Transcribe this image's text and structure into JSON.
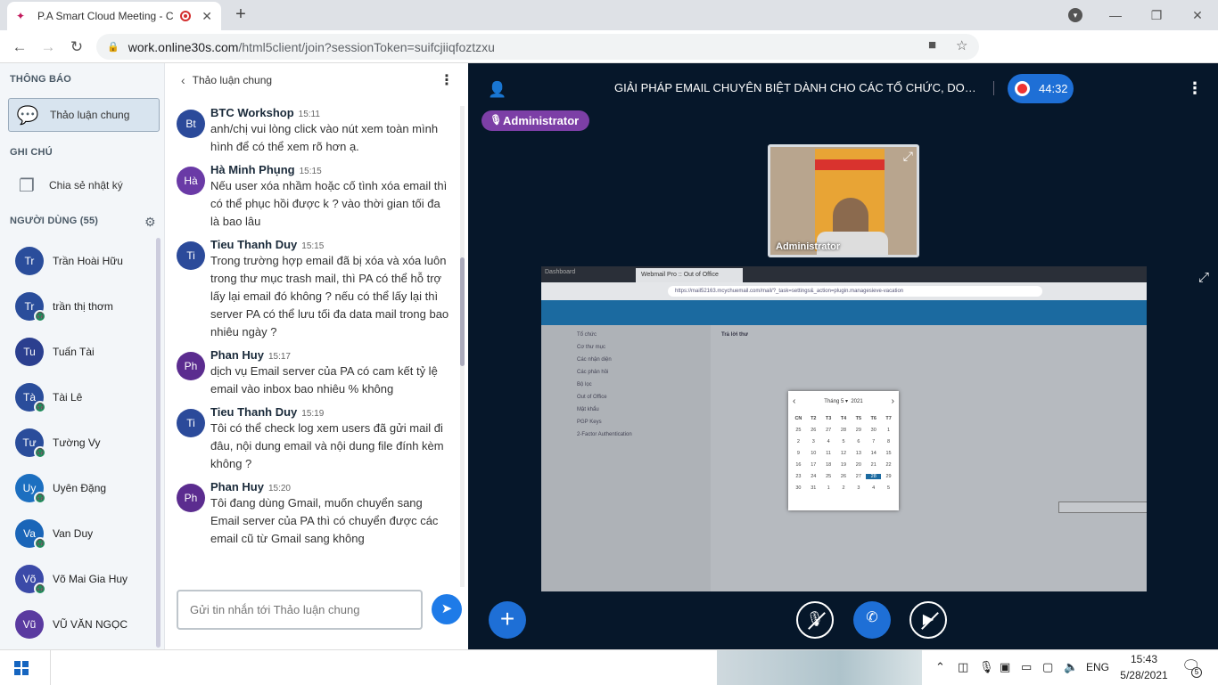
{
  "browser": {
    "tab_title": "P.A Smart Cloud Meeting - C",
    "url_host": "work.online30s.com",
    "url_path": "/html5client/join?sessionToken=suifcjiiqfoztzxu"
  },
  "sidebar": {
    "notifications_title": "THÔNG BÁO",
    "public_chat_label": "Thảo luận chung",
    "notes_title": "GHI CHÚ",
    "shared_notes_label": "Chia sẻ nhật ký",
    "users_title": "NGƯỜI DÙNG (55)",
    "users": [
      {
        "initials": "Tr",
        "name": "Trần Hoài Hữu",
        "color": "#2a4d9b",
        "listen": false
      },
      {
        "initials": "Tr",
        "name": "trần thị thơm",
        "color": "#2a4d9b",
        "listen": true
      },
      {
        "initials": "Tu",
        "name": "Tuấn Tài",
        "color": "#2b3f8f",
        "listen": false
      },
      {
        "initials": "Tà",
        "name": "Tài Lê",
        "color": "#2a4d9b",
        "listen": true
      },
      {
        "initials": "Tư",
        "name": "Tường Vy",
        "color": "#2a4d9b",
        "listen": true
      },
      {
        "initials": "Uy",
        "name": "Uyên Đặng",
        "color": "#1c6fc0",
        "listen": true
      },
      {
        "initials": "Va",
        "name": "Van Duy",
        "color": "#1a65b8",
        "listen": true
      },
      {
        "initials": "Võ",
        "name": "Võ Mai Gia Huy",
        "color": "#3b4aa8",
        "listen": true
      },
      {
        "initials": "Vũ",
        "name": "VŨ VĂN NGỌC",
        "color": "#5a3aa0",
        "listen": false
      }
    ]
  },
  "chat": {
    "title": "Thảo luận chung",
    "input_placeholder": "Gửi tin nhắn tới Thảo luận chung",
    "messages": [
      {
        "initials": "Bt",
        "color": "#2b4a9a",
        "name": "BTC Workshop",
        "time": "15:11",
        "text": "anh/chị vui lòng click vào nút xem toàn mình hình để có thể xem rõ hơn ạ."
      },
      {
        "initials": "Hà",
        "color": "#6a3aa6",
        "name": "Hà Minh Phụng",
        "time": "15:15",
        "text": "Nếu user xóa nhầm hoặc cố tình xóa email thì có thể phục hồi được k ? vào thời gian tối đa là bao lâu"
      },
      {
        "initials": "Ti",
        "color": "#2b4a9a",
        "name": "Tieu Thanh Duy",
        "time": "15:15",
        "text": "Trong trường hợp email đã bị xóa và xóa luôn trong thư mục trash mail, thì PA có thể hỗ trợ lấy lại email đó không ? nếu có thể lấy lại thì server PA có thể lưu tối đa data mail trong bao nhiêu ngày ?"
      },
      {
        "initials": "Ph",
        "color": "#5b2c8f",
        "name": "Phan Huy",
        "time": "15:17",
        "text": "dịch vụ Email server của PA có cam kết tỷ lệ email vào inbox bao nhiêu % không"
      },
      {
        "initials": "Ti",
        "color": "#2b4a9a",
        "name": "Tieu Thanh Duy",
        "time": "15:19",
        "text": "Tôi có thể check log xem users đã gửi mail đi đâu, nội dung email và nội dung file đính kèm không ?"
      },
      {
        "initials": "Ph",
        "color": "#5b2c8f",
        "name": "Phan Huy",
        "time": "15:20",
        "text": "Tôi đang dùng Gmail, muốn chuyển sang Email server của PA thì có chuyển được các email cũ từ Gmail sang không"
      }
    ]
  },
  "meeting": {
    "title": "GIẢI PHÁP EMAIL CHUYÊN BIỆT DÀNH CHO CÁC TỔ CHỨC, DOANH NG...",
    "timer": "44:32",
    "presenter": "Administrator",
    "webcam_label": "Administrator",
    "share": {
      "tab1": "Dashboard",
      "tab2": "Webmail Pro :: Out of Office",
      "url": "https://mail52163.mcychuemail.com/mail/?_task=settings&_action=plugin.managesieve-vacation",
      "side_items": [
        "Tổ chức",
        "Cơ thư mục",
        "Các nhận diện",
        "Các phản hồi",
        "Bộ lọc",
        "Out of Office",
        "Mật khẩu",
        "PGP Keys",
        "2-Factor Authentication"
      ],
      "section": "Trả lời thư",
      "calendar_month": "Tháng 5",
      "calendar_year": "2021",
      "weekdays": [
        "CN",
        "T2",
        "T3",
        "T4",
        "T5",
        "T6",
        "T7"
      ],
      "days": [
        "25",
        "26",
        "27",
        "28",
        "29",
        "30",
        "1",
        "2",
        "3",
        "4",
        "5",
        "6",
        "7",
        "8",
        "9",
        "10",
        "11",
        "12",
        "13",
        "14",
        "15",
        "16",
        "17",
        "18",
        "19",
        "20",
        "21",
        "22",
        "23",
        "24",
        "25",
        "26",
        "27",
        "28",
        "29",
        "30",
        "31",
        "1",
        "2",
        "3",
        "4",
        "5"
      ],
      "selected_day_index": 33
    }
  },
  "taskbar": {
    "lang": "ENG",
    "time": "15:43",
    "date": "5/28/2021",
    "notif_count": "5"
  }
}
